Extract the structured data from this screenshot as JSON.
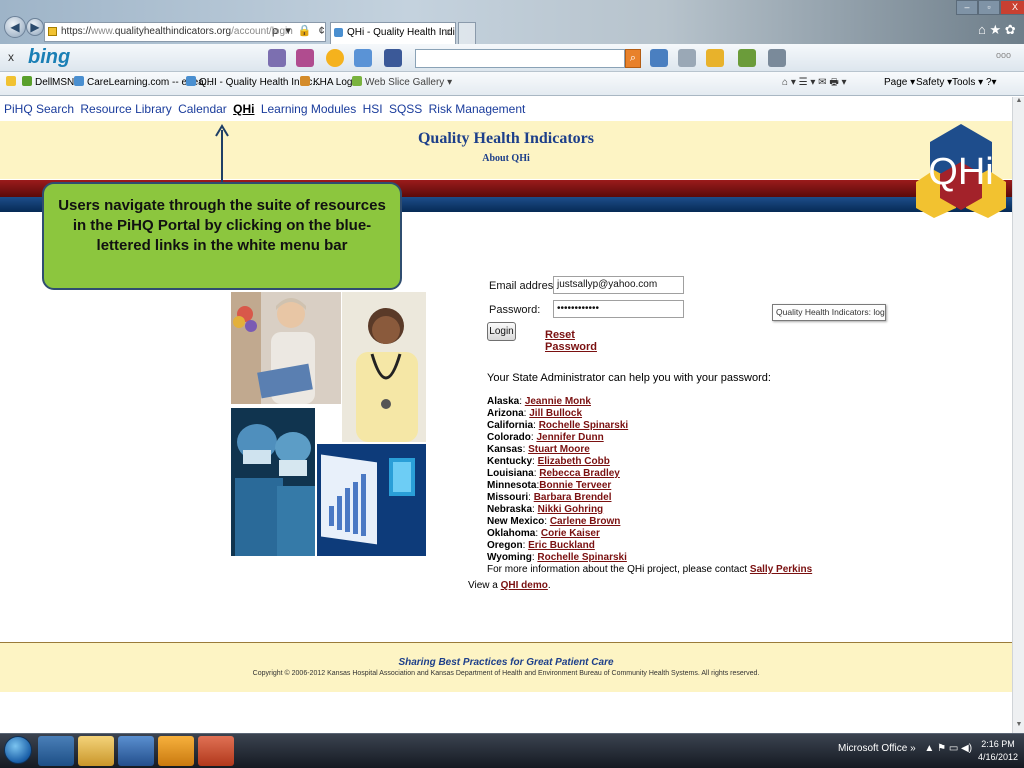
{
  "browser": {
    "address_host": "https://",
    "address_grey": "www.",
    "address_domain": "qualityhealthindicators.org",
    "address_path": "/account/login",
    "address_tools": "ρ ▾ 🔒 ¢ X",
    "tab_active": "QHi - Quality Health Indica...",
    "tab_close": "x",
    "window_buttons": [
      "‒",
      "▫",
      "X"
    ],
    "right_icons": "⌂ ★ ✿"
  },
  "bingbar": {
    "close": "x",
    "logo": "bing",
    "dots": "ooo"
  },
  "favorites": [
    {
      "label": "Dell",
      "icon": "favorites-star-icon"
    },
    {
      "label": "MSN",
      "icon": "msn-icon"
    },
    {
      "label": "CareLearning.com -- eLea...",
      "icon": "ie-page-icon"
    },
    {
      "label": "QHI - Quality Health Indic...",
      "icon": "ie-page-icon"
    },
    {
      "label": "KHA Login",
      "icon": "kha-icon"
    },
    {
      "label": "Web Slice Gallery ▾",
      "icon": "web-slice-icon"
    }
  ],
  "commandbar": {
    "page": "Page ▾",
    "safety": "Safety ▾",
    "tools": "Tools ▾",
    "help": "?▾",
    "icons": "⌂ ▾  ☰ ▾  ✉  🖶 ▾"
  },
  "menubar": [
    "PiHQ Search",
    "Resource Library",
    "Calendar",
    "QHi",
    "Learning Modules",
    "HSI",
    "SQSS",
    "Risk Management"
  ],
  "banner": {
    "title": "Quality Health Indicators",
    "subtitle": "About QHi",
    "logo_text": "QHi"
  },
  "callout": {
    "text": "Users navigate through the suite of resources in the PiHQ Portal by clicking on the blue-lettered links in the white menu bar"
  },
  "form": {
    "email_label": "Email address:",
    "email_value": "justsallyp@yahoo.com",
    "password_label": "Password:",
    "password_value": "••••••••••••",
    "login_button": "Login",
    "reset_link": "Reset Password",
    "tooltip": "Quality Health Indicators: login"
  },
  "help_text": "Your State Administrator can help you with your password:",
  "states": [
    {
      "state": "Alaska",
      "sep": ": ",
      "name": "Jeannie Monk"
    },
    {
      "state": "Arizona",
      "sep": ": ",
      "name": "Jill Bullock"
    },
    {
      "state": "California",
      "sep": ": ",
      "name": "Rochelle Spinarski"
    },
    {
      "state": "Colorado",
      "sep": ": ",
      "name": "Jennifer Dunn"
    },
    {
      "state": "Kansas",
      "sep": ": ",
      "name": "Stuart Moore"
    },
    {
      "state": "Kentucky",
      "sep": ": ",
      "name": "Elizabeth Cobb"
    },
    {
      "state": "Louisiana",
      "sep": ": ",
      "name": "Rebecca Bradley"
    },
    {
      "state": "Minnesota",
      "sep": ":",
      "name": "Bonnie Terveer"
    },
    {
      "state": "Missouri",
      "sep": ": ",
      "name": "Barbara Brendel"
    },
    {
      "state": "Nebraska",
      "sep": ": ",
      "name": "Nikki Gohring"
    },
    {
      "state": "New Mexico",
      "sep": ": ",
      "name": "Carlene Brown"
    },
    {
      "state": "Oklahoma",
      "sep": ": ",
      "name": "Corie Kaiser"
    },
    {
      "state": "Oregon",
      "sep": ": ",
      "name": "Eric Buckland"
    },
    {
      "state": "Wyoming",
      "sep": ": ",
      "name": "Rochelle Spinarski"
    }
  ],
  "more_info": {
    "text": "For more information about the QHi project, please contact ",
    "link": "Sally Perkins"
  },
  "demo": {
    "prefix": "View a ",
    "link": "QHI demo",
    "suffix": "."
  },
  "footer": {
    "tagline": "Sharing Best Practices for Great Patient Care",
    "copyright": "Copyright © 2006-2012 Kansas Hospital Association and Kansas Department of Health and Environment Bureau of Community Health Systems. All rights reserved."
  },
  "taskbar": {
    "tray_label": "Microsoft Office",
    "tray_chevron": "»",
    "tray_icons": "▲  ⚑  ▭  ◀)",
    "time": "2:16 PM",
    "date": "4/16/2012"
  },
  "colors": {
    "banner_bg": "#fdf4c4",
    "title_blue": "#1d3f8a",
    "link_red": "#7a1010",
    "callout_green": "#8cc63e",
    "stripe_red": "#9b1c1c",
    "stripe_blue": "#062a55"
  }
}
